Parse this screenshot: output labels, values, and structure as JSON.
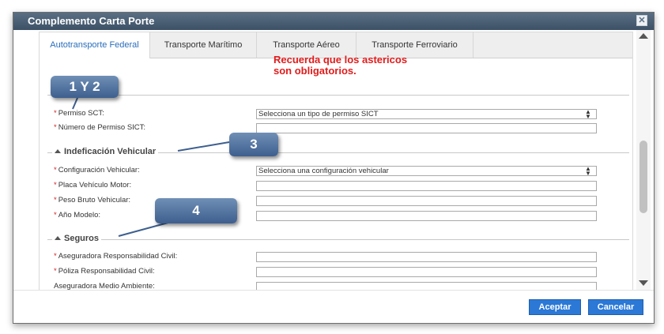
{
  "dialog": {
    "title": "Complemento Carta Porte",
    "close_glyph": "✕"
  },
  "tabs": [
    {
      "label": "Autotransporte Federal",
      "active": true
    },
    {
      "label": "Transporte Marítimo",
      "active": false
    },
    {
      "label": "Transporte Aéreo",
      "active": false
    },
    {
      "label": "Transporte Ferroviario",
      "active": false
    }
  ],
  "note": {
    "line1": "Recuerda que los astericos",
    "line2": "son obligatorios."
  },
  "permiso": {
    "permiso_sct_label": "Permiso SCT:",
    "permiso_sct_placeholder": "Selecciona un tipo de permiso SICT",
    "numero_permiso_label": "Número de Permiso SICT:",
    "numero_permiso_value": ""
  },
  "vehicular": {
    "legend": "Indeficación Vehicular",
    "configuracion_label": "Configuración Vehicular:",
    "configuracion_placeholder": "Selecciona una configuración vehicular",
    "placa_label": "Placa Vehículo Motor:",
    "peso_label": "Peso Bruto Vehicular:",
    "anio_label": "Año Modelo:"
  },
  "seguros": {
    "legend": "Seguros",
    "aseguradora_rc_label": "Aseguradora Responsabilidad Civil:",
    "poliza_rc_label": "Póliza Responsabilidad Civil:",
    "aseguradora_ma_label": "Aseguradora Medio Ambiente:"
  },
  "callouts": {
    "c1": "1 Y 2",
    "c3": "3",
    "c4": "4"
  },
  "footer": {
    "accept_label": "Aceptar",
    "cancel_label": "Cancelar"
  },
  "colors": {
    "accent": "#2b78d6",
    "required": "#d42020",
    "note": "#e21b1b",
    "title_bar": "#4a5f74"
  }
}
